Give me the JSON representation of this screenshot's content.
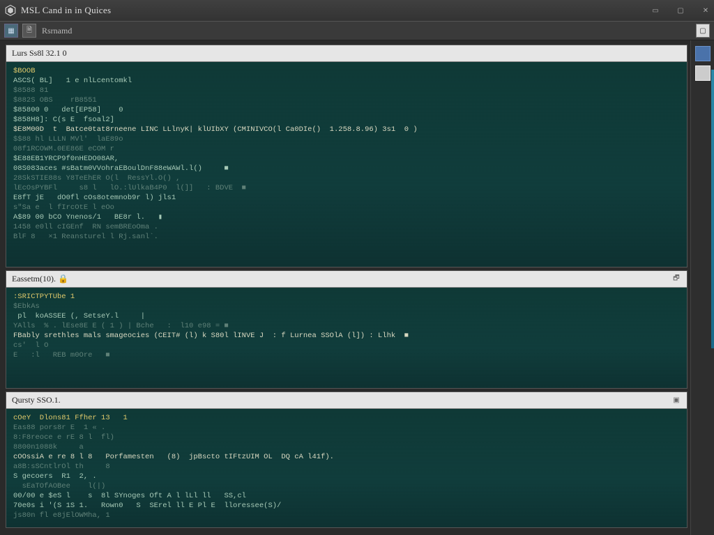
{
  "window": {
    "title": "MSL Cand in in Quices",
    "min_glyph": "▭",
    "max_glyph": "▢",
    "close_glyph": "✕"
  },
  "toolbar": {
    "btn1_glyph": "▦",
    "btn2_glyph": "🗎",
    "tab_name": "Rsrnamd",
    "right_btn1": "▢",
    "right_btn2": "▦"
  },
  "panels": [
    {
      "id": "panel1",
      "header": "Lurs Ss8l 32.1 0",
      "lines": [
        {
          "t": "$BOOB",
          "cls": "kw"
        },
        {
          "t": "ASCS( BL]   1 e nlLcentomkl",
          "cls": ""
        },
        {
          "t": "$8588 81           ",
          "cls": "dim"
        },
        {
          "t": "$882S OBS    rB8551",
          "cls": "dim"
        },
        {
          "t": "$85800 0   det[EP58]    0",
          "cls": ""
        },
        {
          "t": "$858H8]: C(s E  fsoal2]",
          "cls": ""
        },
        {
          "t": "$E8M00D  t  Batce0tat8rneene LINC LLlnyK| klUIbXY (CMINIVCO(l Ca0DIe()  1.258.8.96) 3s1  0 )",
          "cls": "hl"
        },
        {
          "t": "$$88 hl LLLN MVl'  laE89o",
          "cls": "dim"
        },
        {
          "t": "08f1RCOWM.0EE86E eCOM r           ",
          "cls": "dim"
        },
        {
          "t": "$E88EB1YRCP9f0nHEDO08AR,",
          "cls": ""
        },
        {
          "t": "08S083aces #sBatm0VVohraEBoulDnF88eWAWl.l()     ■",
          "cls": ""
        },
        {
          "t": "28SkSTIE88s Y8TeEhER O(l  RessYl.O() ,",
          "cls": "dim"
        },
        {
          "t": "lEcOsPYBFl     s8 l   lO.:lUlkaB4P0  l(]]   : BDVE  ■",
          "cls": "dim"
        },
        {
          "t": "E8fT jE   dO0fl cOs8otemnob9r l) jls1",
          "cls": ""
        },
        {
          "t": "s\"Sa e  l fIrcOtE l eOo               ",
          "cls": "dim"
        },
        {
          "t": "A$89 00 bCO Ynenos/1   BE8r l.   ▮",
          "cls": ""
        },
        {
          "t": "1458 e0ll cIGEnf  RN semBREoOma .",
          "cls": "dim"
        },
        {
          "t": "",
          "cls": ""
        },
        {
          "t": "BlF 8   ×1 Reansturel l Rj.sanl`.",
          "cls": "dim"
        }
      ]
    },
    {
      "id": "panel2",
      "header": "Eassetm(10). 🔒",
      "right_icon": "🗗",
      "lines": [
        {
          "t": ":SRICTPYTUbe 1",
          "cls": "kw"
        },
        {
          "t": "$EbkAs",
          "cls": "dim"
        },
        {
          "t": " pl  koASSEE (, SetseY.l     |",
          "cls": ""
        },
        {
          "t": "YAlls  % . lEse8E E ( 1 ) | Bche   :  l10 e98 = ■",
          "cls": "dim"
        },
        {
          "t": "",
          "cls": ""
        },
        {
          "t": "FBably srethles mals smageocies (CEIT# (l) k S80l lINVE J  : f Lurnea SSOlA (l]) : Llhk  ■  ",
          "cls": "hl"
        },
        {
          "t": "cs'  l O",
          "cls": "dim"
        },
        {
          "t": "E   :l   REB m0Ore   ■",
          "cls": "dim"
        }
      ]
    },
    {
      "id": "panel3",
      "header": "Qursty SSO.1.",
      "right_icon": "▣",
      "lines": [
        {
          "t": "cOeY  Dlons81 Ffher 13   1",
          "cls": "kw"
        },
        {
          "t": "Eas88 pors8r E  1 « .",
          "cls": "dim"
        },
        {
          "t": "8:F8reoce e rE 8 l  fl)  ",
          "cls": "dim"
        },
        {
          "t": "8800n1088k     a",
          "cls": "dim"
        },
        {
          "t": "cOOssiA e re 8 l 8   Porfamesten   (8)  jpBscto tIFtzUIM OL  DQ cA l41f).",
          "cls": "hl"
        },
        {
          "t": "a8B:sSCntlrOl th     8",
          "cls": "dim"
        },
        {
          "t": "S gecoers  R1  2, .",
          "cls": ""
        },
        {
          "t": "  sEaTOfAOBee    l(|)",
          "cls": "dim"
        },
        {
          "t": "00/00 e $eS l    s  8l SYnoges Oft A l lLl ll   SS,cl",
          "cls": ""
        },
        {
          "t": "70e0s i '(S 1S 1.   Rown0   S  SErel ll E Pl E  lloressee(S)/",
          "cls": ""
        },
        {
          "t": "js80n fl e8jElOWMha, 1 ",
          "cls": "dim"
        }
      ]
    }
  ]
}
